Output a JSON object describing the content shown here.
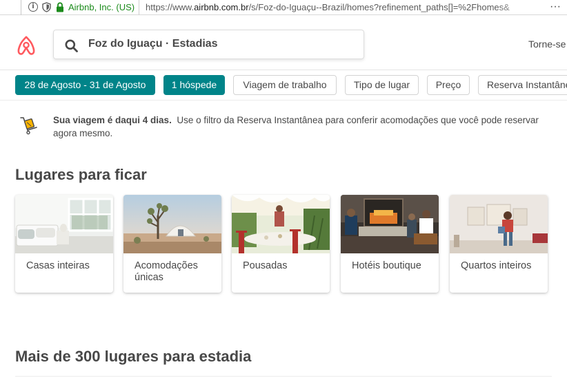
{
  "browser": {
    "info_glyph": "i",
    "site_identity": "Airbnb, Inc. (US)",
    "url_prefix": "https://www.",
    "url_domain": "airbnb.com.br",
    "url_path": "/s/Foz-do-Iguaçu--Brazil/homes?refinement_paths[]=%2Fhomes&",
    "more_glyph": "···",
    "identity_color": "#1c8b1c"
  },
  "header": {
    "logo_icon": "airbnb-belo-logo",
    "brand_color": "#ff5a5f",
    "search_value": "Foz do Iguaçu · Estadias",
    "host_link": "Torne-se"
  },
  "filters": {
    "accent_color": "#008489",
    "dates": "28 de Agosto - 31 de Agosto",
    "guests": "1 hóspede",
    "work_trip": "Viagem de trabalho",
    "place_type": "Tipo de lugar",
    "price": "Preço",
    "instant_book": "Reserva Instantânea"
  },
  "notice": {
    "icon": "luggage-trolley-icon",
    "bold_text": "Sua viagem é daqui 4 dias.",
    "text": "Use o filtro da Reserva Instantânea para conferir acomodações que você pode reservar agora mesmo."
  },
  "places": {
    "title": "Lugares para ficar",
    "cards": [
      {
        "label": "Casas inteiras"
      },
      {
        "label": "Acomodações únicas"
      },
      {
        "label": "Pousadas"
      },
      {
        "label": "Hotéis boutique"
      },
      {
        "label": "Quartos inteiros"
      }
    ]
  },
  "listings": {
    "title": "Mais de 300 lugares para estadia"
  }
}
